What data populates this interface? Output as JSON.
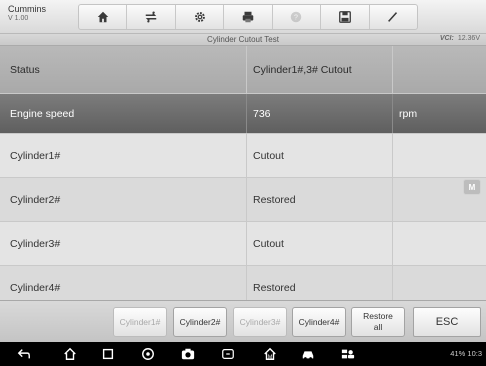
{
  "brand": {
    "name": "Cummins",
    "version": "V 1.00"
  },
  "toolbar": {
    "items": [
      {
        "icon": "home-icon"
      },
      {
        "icon": "vehicle-swap-icon"
      },
      {
        "icon": "gear-icon"
      },
      {
        "icon": "printer-icon"
      },
      {
        "icon": "help-icon",
        "disabled": true
      },
      {
        "icon": "save-icon"
      },
      {
        "icon": "pen-icon"
      }
    ]
  },
  "screen": {
    "title": "Cylinder Cutout Test",
    "vci_label": "VCI:",
    "battery": "12.36V"
  },
  "table": {
    "header": {
      "name": "Status",
      "value": "Cylinder1#,3# Cutout",
      "unit": ""
    },
    "rows": [
      {
        "name": "Engine speed",
        "value": "736",
        "unit": "rpm",
        "selected": true
      },
      {
        "name": "Cylinder1#",
        "value": "Cutout",
        "unit": ""
      },
      {
        "name": "Cylinder2#",
        "value": "Restored",
        "unit": ""
      },
      {
        "name": "Cylinder3#",
        "value": "Cutout",
        "unit": ""
      },
      {
        "name": "Cylinder4#",
        "value": "Restored",
        "unit": ""
      }
    ]
  },
  "floating_badge": "M",
  "actions": {
    "cyl1": "Cylinder1#",
    "cyl2": "Cylinder2#",
    "cyl3": "Cylinder3#",
    "cyl4": "Cylinder4#",
    "restore_line1": "Restore",
    "restore_line2": "all",
    "esc": "ESC"
  },
  "system_bar": {
    "status": "41% 10:3"
  },
  "colors": {
    "selected_row": "#6e6e6e",
    "header_row": "#b0b0b0",
    "background": "#e4e4e4"
  }
}
